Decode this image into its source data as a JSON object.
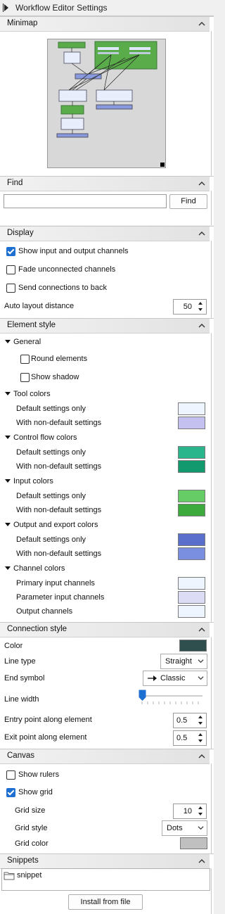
{
  "window": {
    "title": "Workflow Editor Settings"
  },
  "minimap": {
    "header": "Minimap"
  },
  "find": {
    "header": "Find",
    "input_value": "",
    "button": "Find"
  },
  "display": {
    "header": "Display",
    "show_channels": {
      "label": "Show input and output channels",
      "checked": true
    },
    "fade_unconnected": {
      "label": "Fade unconnected channels",
      "checked": false
    },
    "send_back": {
      "label": "Send connections to back",
      "checked": false
    },
    "auto_layout": {
      "label": "Auto layout distance",
      "value": "50"
    }
  },
  "element_style": {
    "header": "Element style",
    "general": {
      "label": "General",
      "round": {
        "label": "Round elements",
        "checked": false
      },
      "shadow": {
        "label": "Show shadow",
        "checked": false
      }
    },
    "tool_colors": {
      "label": "Tool colors",
      "default": "Default settings only",
      "nondefault": "With non-default settings",
      "default_color": "#eef5ff",
      "nondefault_color": "#c4c0f0"
    },
    "control_flow": {
      "label": "Control flow colors",
      "default": "Default settings only",
      "nondefault": "With non-default settings",
      "default_color": "#2bb58c",
      "nondefault_color": "#129a6e"
    },
    "input_colors": {
      "label": "Input colors",
      "default": "Default settings only",
      "nondefault": "With non-default settings",
      "default_color": "#66cc66",
      "nondefault_color": "#3caa3c"
    },
    "output_colors": {
      "label": "Output and export colors",
      "default": "Default settings only",
      "nondefault": "With non-default settings",
      "default_color": "#5a6fcc",
      "nondefault_color": "#7a8fe0"
    },
    "channel_colors": {
      "label": "Channel colors",
      "primary": "Primary input channels",
      "parameter": "Parameter input channels",
      "output": "Output channels",
      "primary_color": "#eef5ff",
      "parameter_color": "#dcdcf4",
      "output_color": "#eef5ff"
    }
  },
  "connection_style": {
    "header": "Connection style",
    "color_label": "Color",
    "color": "#2f4f4f",
    "line_type": {
      "label": "Line type",
      "value": "Straight"
    },
    "end_symbol": {
      "label": "End symbol",
      "value": "Classic",
      "icon": "arrow-right-icon"
    },
    "line_width": {
      "label": "Line width",
      "level": 0
    },
    "entry_point": {
      "label": "Entry point along element",
      "value": "0.5"
    },
    "exit_point": {
      "label": "Exit point along element",
      "value": "0.5"
    }
  },
  "canvas": {
    "header": "Canvas",
    "show_rulers": {
      "label": "Show rulers",
      "checked": false
    },
    "show_grid": {
      "label": "Show grid",
      "checked": true
    },
    "grid_size": {
      "label": "Grid size",
      "value": "10"
    },
    "grid_style": {
      "label": "Grid style",
      "value": "Dots"
    },
    "grid_color": {
      "label": "Grid color",
      "color": "#c0c0c0"
    }
  },
  "snippets": {
    "header": "Snippets",
    "items": [
      "snippet"
    ],
    "install_button": "Install from file"
  }
}
